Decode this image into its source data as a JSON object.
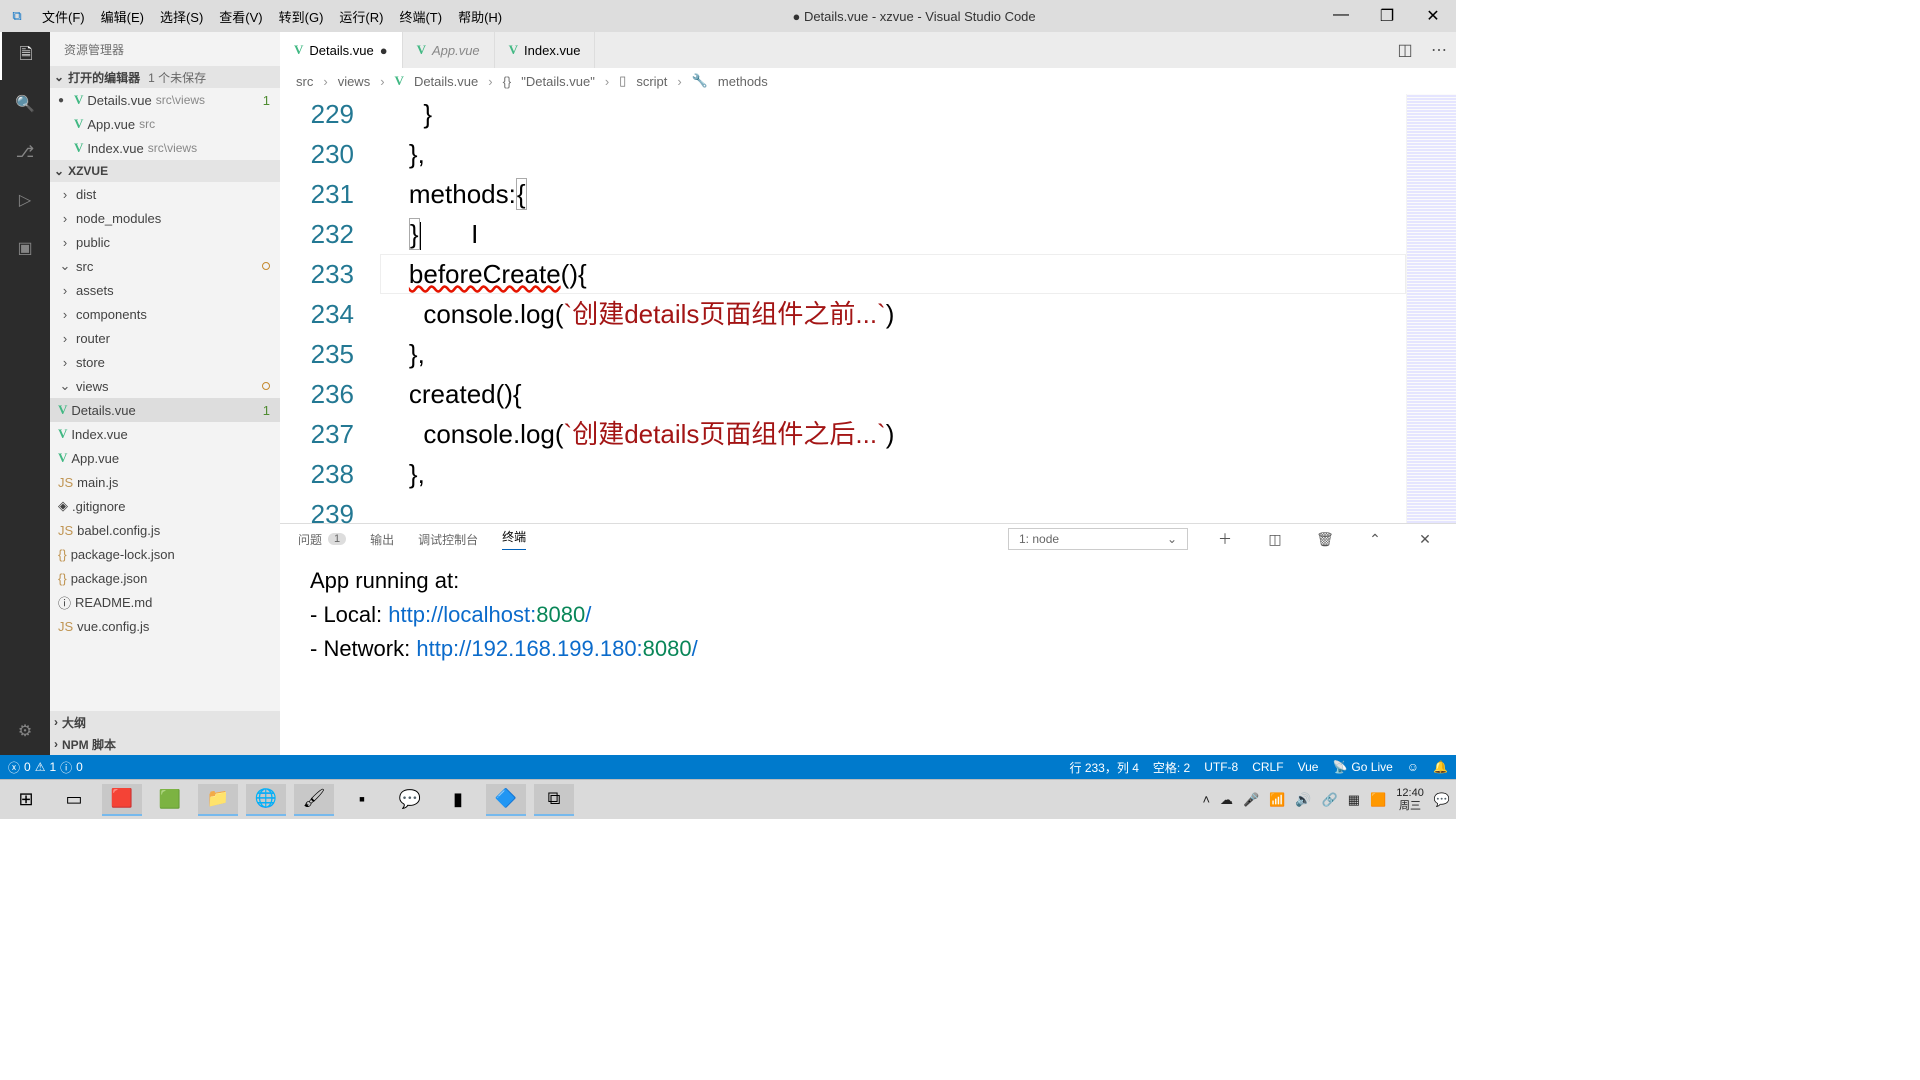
{
  "window": {
    "dirty_marker": "●",
    "title": "Details.vue - xzvue - Visual Studio Code"
  },
  "menu": [
    "文件(F)",
    "编辑(E)",
    "选择(S)",
    "查看(V)",
    "转到(G)",
    "运行(R)",
    "终端(T)",
    "帮助(H)"
  ],
  "explorer": {
    "header": "资源管理器",
    "open_editors_label": "打开的编辑器",
    "open_editors_badge": "1 个未保存",
    "open_items": [
      {
        "name": "Details.vue",
        "path": "src\\views",
        "num": "1",
        "dirty": true
      },
      {
        "name": "App.vue",
        "path": "src"
      },
      {
        "name": "Index.vue",
        "path": "src\\views"
      }
    ],
    "project": "XZVUE",
    "tree": {
      "dist": "dist",
      "node_modules": "node_modules",
      "public": "public",
      "src": "src",
      "assets": "assets",
      "components": "components",
      "router": "router",
      "store": "store",
      "views": "views",
      "details": "Details.vue",
      "index": "Index.vue",
      "app": "App.vue",
      "main": "main.js",
      "gitignore": ".gitignore",
      "babel": "babel.config.js",
      "pkglock": "package-lock.json",
      "pkg": "package.json",
      "readme": "README.md",
      "vuecfg": "vue.config.js"
    },
    "details_num": "1",
    "outline": "大纲",
    "npm": "NPM 脚本"
  },
  "tabs": [
    {
      "name": "Details.vue",
      "active": true,
      "dirty": true
    },
    {
      "name": "App.vue",
      "dim": true
    },
    {
      "name": "Index.vue"
    }
  ],
  "breadcrumb": {
    "parts": [
      "src",
      "views",
      "Details.vue",
      "\"Details.vue\"",
      "script",
      "methods"
    ]
  },
  "code": {
    "lines": [
      {
        "n": "229",
        "t": "      }"
      },
      {
        "n": "230",
        "t": "    },"
      },
      {
        "n": "231",
        "t": "    methods:{",
        "hl": true
      },
      {
        "n": "232",
        "t": ""
      },
      {
        "n": "233",
        "t": "    }",
        "cursor": true
      },
      {
        "n": "234",
        "err": "beforeCreate",
        "rest": "(){"
      },
      {
        "n": "235",
        "log": "创建details页面组件之前..."
      },
      {
        "n": "236",
        "t": "    },"
      },
      {
        "n": "237",
        "t": "    created(){"
      },
      {
        "n": "238",
        "log": "创建details页面组件之后..."
      },
      {
        "n": "239",
        "t": "    },"
      }
    ]
  },
  "panel": {
    "problems": "问题",
    "problems_count": "1",
    "output": "输出",
    "debug": "调试控制台",
    "terminal": "终端",
    "terminal_sel": "1: node",
    "body": {
      "l1": "App running at:",
      "l2a": "- Local:   ",
      "l2b": "http://localhost:",
      "l2port": "8080",
      "l2c": "/",
      "l3a": "- Network: ",
      "l3b": "http://192.168.199.180:",
      "l3port": "8080",
      "l3c": "/"
    }
  },
  "status": {
    "err": "0",
    "warn": "1",
    "info": "0",
    "pos": "行 233，列 4",
    "spaces": "空格: 2",
    "enc": "UTF-8",
    "eol": "CRLF",
    "lang": "Vue",
    "golive": "Go Live"
  },
  "tray": {
    "time": "12:40",
    "date": "周三"
  }
}
